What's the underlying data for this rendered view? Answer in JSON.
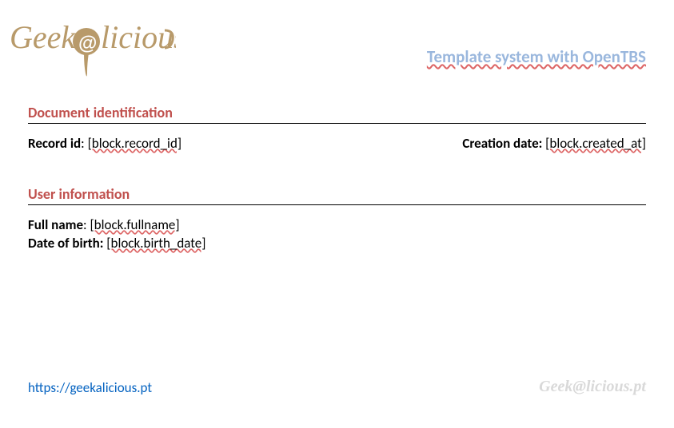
{
  "header": {
    "logo_text_1": "Geek",
    "logo_text_2": "licious",
    "title": "Template system with OpenTBS"
  },
  "sections": {
    "doc_id": {
      "heading": "Document identification",
      "record_label": "Record id",
      "record_value": "[block.record_id]",
      "creation_label": "Creation date:",
      "creation_value": "[block.created_at]"
    },
    "user": {
      "heading": "User information",
      "fullname_label": "Full name",
      "fullname_value": "[block.fullname]",
      "dob_label": "Date of birth:",
      "dob_value": "[block.birth_date]"
    }
  },
  "footer": {
    "link": "https://geekalicious.pt",
    "watermark": "Geek@licious.pt"
  }
}
